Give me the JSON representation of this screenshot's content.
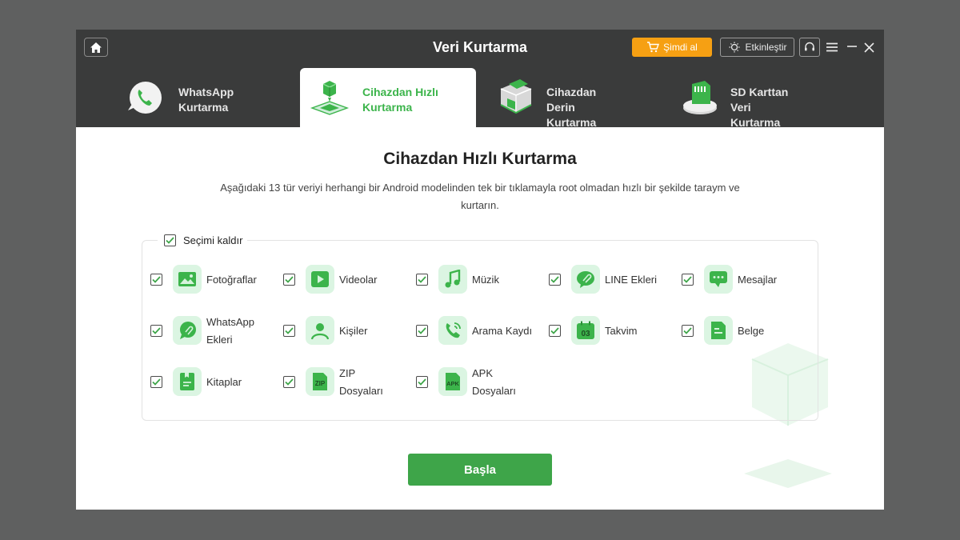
{
  "window": {
    "title": "Veri Kurtarma",
    "buy_label": "Şimdi al",
    "engage_label": "Etkinleştir"
  },
  "tabs": [
    {
      "label": "WhatsApp\nKurtarma",
      "icon": "whatsapp-phone-icon",
      "active": false
    },
    {
      "label": "Cihazdan Hızlı\nKurtarma",
      "icon": "quick-recovery-icon",
      "active": true
    },
    {
      "label": "Cihazdan Derin\nKurtarma",
      "icon": "deep-recovery-icon",
      "active": false
    },
    {
      "label": "SD Karttan Veri\nKurtarma",
      "icon": "sd-card-icon",
      "active": false
    }
  ],
  "content": {
    "title": "Cihazdan Hızlı Kurtarma",
    "description": "Aşağıdaki 13 tür veriyi herhangi bir Android modelinden tek bir tıklamayla root olmadan hızlı bir şekilde taraym ve kurtarın.",
    "select_all_label": "Seçimi kaldır",
    "start_label": "Başla"
  },
  "data_types": [
    {
      "label": "Fotoğraflar",
      "icon": "photo-icon",
      "checked": true
    },
    {
      "label": "Videolar",
      "icon": "video-icon",
      "checked": true
    },
    {
      "label": "Müzik",
      "icon": "music-icon",
      "checked": true
    },
    {
      "label": "LINE Ekleri",
      "icon": "line-attachment-icon",
      "checked": true
    },
    {
      "label": "Mesajlar",
      "icon": "message-icon",
      "checked": true
    },
    {
      "label": "WhatsApp\nEkleri",
      "icon": "whatsapp-attachment-icon",
      "checked": true
    },
    {
      "label": "Kişiler",
      "icon": "contact-icon",
      "checked": true
    },
    {
      "label": "Arama Kaydı",
      "icon": "call-log-icon",
      "checked": true
    },
    {
      "label": "Takvim",
      "icon": "calendar-icon",
      "checked": true
    },
    {
      "label": "Belge",
      "icon": "document-icon",
      "checked": true
    },
    {
      "label": "Kitaplar",
      "icon": "book-icon",
      "checked": true
    },
    {
      "label": "ZIP\nDosyaları",
      "icon": "zip-icon",
      "checked": true
    },
    {
      "label": "APK\nDosyaları",
      "icon": "apk-icon",
      "checked": true
    }
  ],
  "icon_text": {
    "calendar_day": "03",
    "zip": "ZIP",
    "apk": "APK"
  },
  "colors": {
    "accent_green": "#3cb44b",
    "button_green": "#3ea549",
    "buy_orange": "#f6a013",
    "titlebar": "#3a3b3b"
  }
}
